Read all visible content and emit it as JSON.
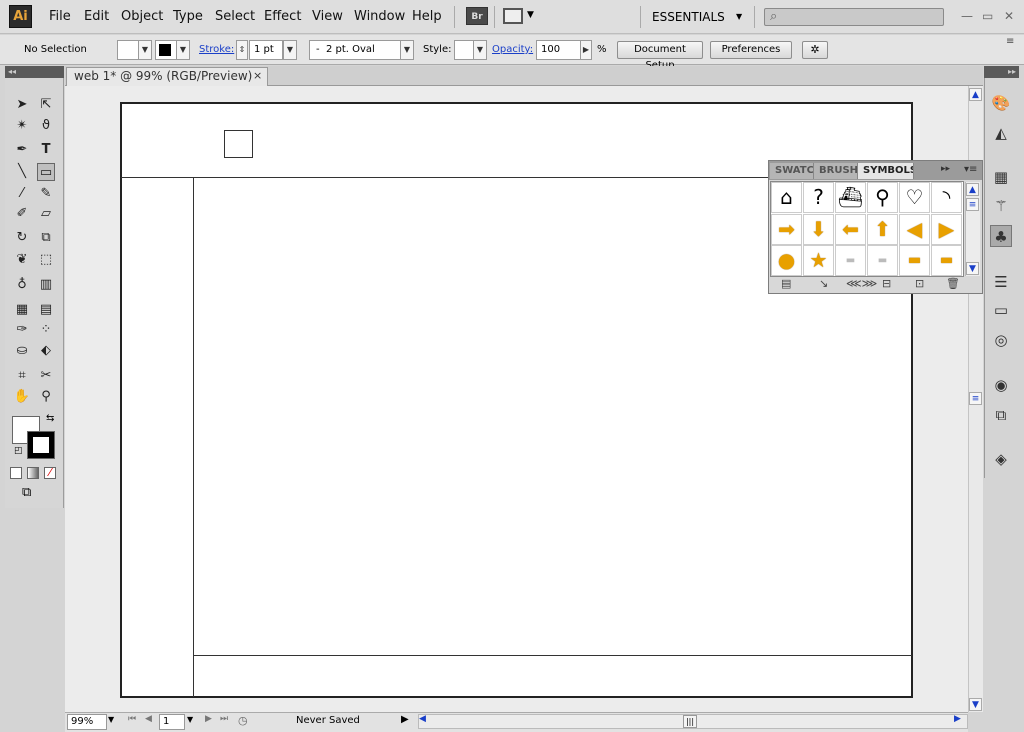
{
  "app": {
    "logo": "Ai",
    "bridge_label": "Br",
    "workspace": "ESSENTIALS",
    "search_placeholder": ""
  },
  "menu": [
    "File",
    "Edit",
    "Object",
    "Type",
    "Select",
    "Effect",
    "View",
    "Window",
    "Help"
  ],
  "control": {
    "selection": "No Selection",
    "stroke_label": "Stroke:",
    "stroke_weight": "1 pt",
    "brush": "2 pt. Oval",
    "brush_prefix": "-",
    "style_label": "Style:",
    "opacity_label": "Opacity:",
    "opacity_value": "100",
    "opacity_unit": "%",
    "document_setup": "Document Setup",
    "preferences": "Preferences"
  },
  "document": {
    "tab_title": "web 1* @ 99% (RGB/Preview)",
    "close": "×"
  },
  "status": {
    "zoom": "99%",
    "page": "1",
    "save_state": "Never Saved"
  },
  "symbols_panel": {
    "tabs": [
      "SWATCHES",
      "BRUSHES",
      "SYMBOLS"
    ],
    "active_tab": "SYMBOLS",
    "symbols": [
      "home-icon",
      "help-icon",
      "basket-icon",
      "search-icon",
      "heart-icon",
      "rss-icon",
      "arrow-right-icon",
      "arrow-down-icon",
      "arrow-left-icon",
      "arrow-up-icon",
      "triangle-left-icon",
      "triangle-right-icon",
      "circle-button-icon",
      "star-icon",
      "bar-plain-icon",
      "bar-line-icon",
      "bar-gold-icon",
      "bar-gold-2-icon"
    ]
  },
  "colors": {
    "accent_link": "#1a3fc8",
    "symbol_gold": "#e8a000"
  }
}
